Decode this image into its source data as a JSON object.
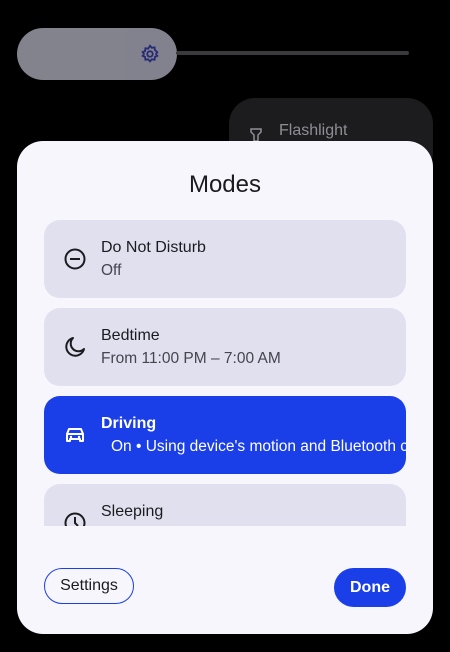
{
  "background": {
    "flashlight_label": "Flashlight"
  },
  "dialog": {
    "title": "Modes",
    "modes": [
      {
        "name": "Do Not Disturb",
        "status": "Off",
        "icon": "do-not-disturb-icon",
        "active": false
      },
      {
        "name": "Bedtime",
        "status": "From 11:00 PM – 7:00 AM",
        "icon": "moon-icon",
        "active": false
      },
      {
        "name": "Driving",
        "status": "On • Using device's motion and Bluetooth connection",
        "icon": "car-icon",
        "active": true
      },
      {
        "name": "Sleeping",
        "status": "",
        "icon": "clock-icon",
        "active": false
      }
    ],
    "settings_label": "Settings",
    "done_label": "Done"
  },
  "colors": {
    "accent": "#1a3fe8",
    "card": "#e1e0ef",
    "dialog_bg": "#f7f6fd"
  }
}
